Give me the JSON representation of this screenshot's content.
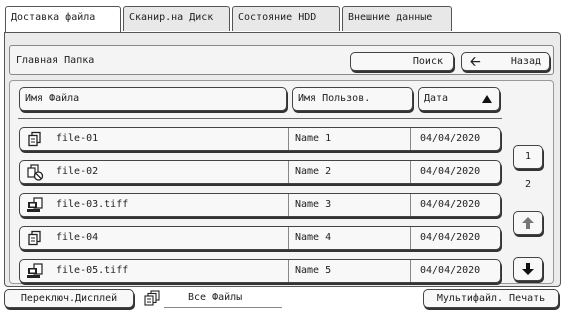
{
  "tabs": [
    {
      "label": "Доставка файла",
      "active": true
    },
    {
      "label": "Сканир.на Диск",
      "active": false
    },
    {
      "label": "Состояние HDD",
      "active": false
    },
    {
      "label": "Внешние данные",
      "active": false
    }
  ],
  "path": {
    "folder": "Главная Папка",
    "search_label": "Поиск",
    "back_label": "Назад",
    "back_icon": "left-arrow-icon"
  },
  "columns": {
    "name": "Имя Файла",
    "user": "Имя Пользов.",
    "date": "Дата",
    "sort_icon": "sort-ascending-icon"
  },
  "files": [
    {
      "icon": "copy-document-icon",
      "name": "file-01",
      "user": "Name 1",
      "date": "04/04/2020"
    },
    {
      "icon": "copy-forbidden-icon",
      "name": "file-02",
      "user": "Name 2",
      "date": "04/04/2020"
    },
    {
      "icon": "computer-document-icon",
      "name": "file-03.tiff",
      "user": "Name 3",
      "date": "04/04/2020"
    },
    {
      "icon": "copy-document-icon",
      "name": "file-04",
      "user": "Name 4",
      "date": "04/04/2020"
    },
    {
      "icon": "computer-document-icon",
      "name": "file-05.tiff",
      "user": "Name 5",
      "date": "04/04/2020"
    }
  ],
  "pager": {
    "current": "1",
    "total": "2",
    "up_icon": "arrow-up-icon",
    "down_icon": "arrow-down-icon"
  },
  "footer": {
    "switch_display_label": "Переключ.Дисплей",
    "filter_icon": "all-files-icon",
    "filter_value": "Все Файлы",
    "multi_print_label": "Мультифайл. Печать"
  }
}
